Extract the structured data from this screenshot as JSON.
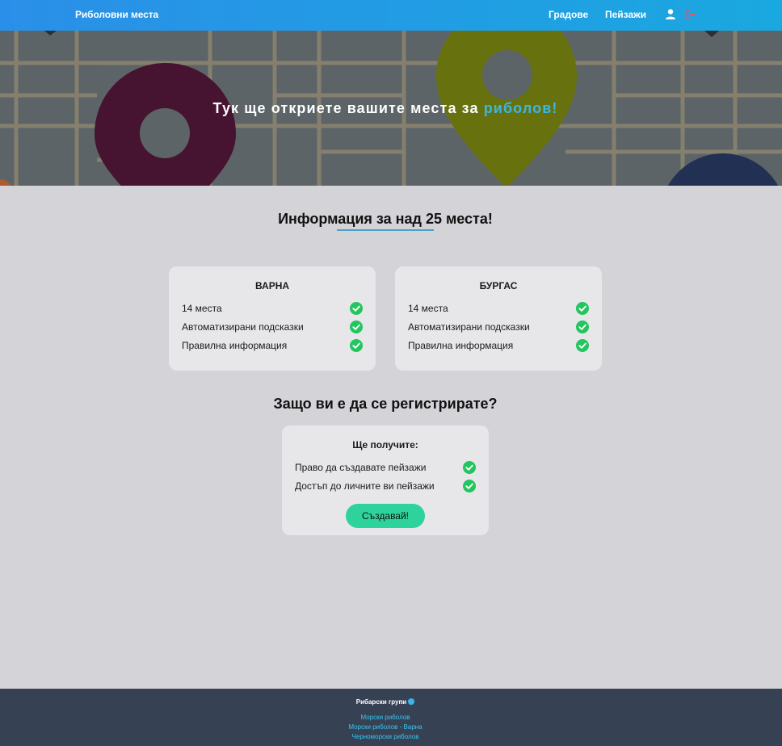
{
  "navbar": {
    "brand": "Риболовни места",
    "links": [
      "Градове",
      "Пейзажи"
    ],
    "icons": [
      "user-icon",
      "logout-icon"
    ]
  },
  "hero": {
    "title_main": "Тук ще откриете вашите места за ",
    "title_accent": "риболов!"
  },
  "info_section": {
    "heading": "Информация за над 25 места!",
    "cards": [
      {
        "title": "ВАРНА",
        "rows": [
          "14 места",
          "Автоматизирани подсказки",
          "Правилна информация"
        ]
      },
      {
        "title": "БУРГАС",
        "rows": [
          "14 места",
          "Автоматизирани подсказки",
          "Правилна информация"
        ]
      }
    ]
  },
  "register_section": {
    "heading": "Защо ви е да се регистрирате?",
    "card_title": "Ще получите:",
    "rows": [
      "Право да създавате пейзажи",
      "Достъп до личните ви пейзажи"
    ],
    "button": "Създавай!"
  },
  "footer": {
    "title": "Рибарски групи",
    "links": [
      "Морски риболов",
      "Морски риболов - Варна",
      "Черноморски риболов"
    ]
  },
  "colors": {
    "nav_gradient": [
      "#2a8fe8",
      "#1aa8e0"
    ],
    "accent": "#3ab7e6",
    "check": "#22c55e",
    "button": "#2ed39b",
    "footer": "#374154",
    "page_bg": "#d4d3d8"
  }
}
